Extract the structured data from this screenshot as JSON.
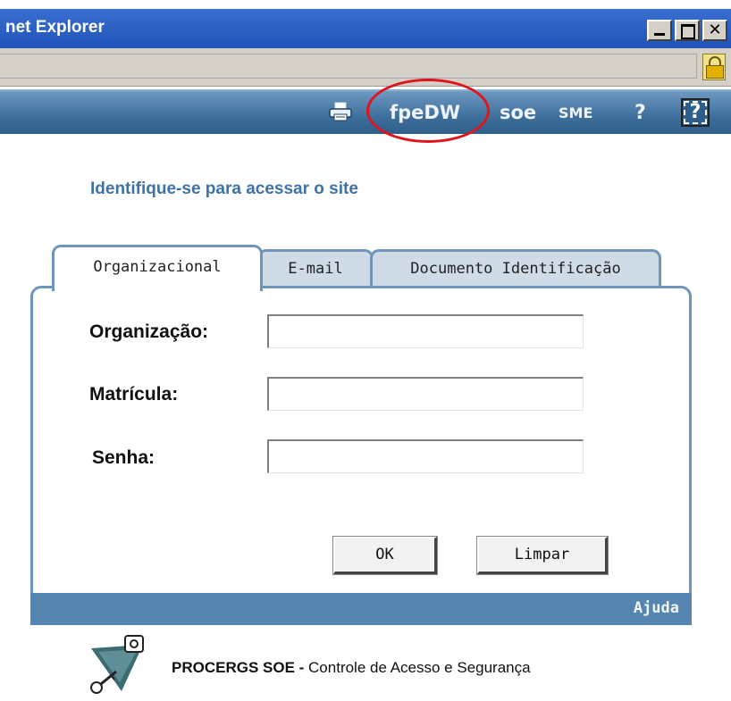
{
  "window": {
    "title": "net Explorer",
    "buttons": {
      "minimize": "minimize",
      "maximize": "maximize",
      "close": "✕"
    }
  },
  "site_header": {
    "links": [
      "fpeDW",
      "soe",
      "SME",
      "?"
    ],
    "icons": [
      "printer-icon",
      "help-box-icon"
    ],
    "annotation": "red circle around fpeDW"
  },
  "page": {
    "heading": "Identifique-se para acessar o site",
    "tabs": [
      {
        "label": "Organizacional",
        "active": true
      },
      {
        "label": "E-mail",
        "active": false
      },
      {
        "label": "Documento Identificação",
        "active": false
      }
    ],
    "form": {
      "fields": [
        {
          "label": "Organização:",
          "value": ""
        },
        {
          "label": "Matrícula:",
          "value": ""
        },
        {
          "label": "Senha:",
          "value": ""
        }
      ],
      "ok_label": "OK",
      "clear_label": "Limpar"
    },
    "footer_help": "Ajuda"
  },
  "brand": {
    "name": "PROCERGS SOE",
    "separator": " - ",
    "description": "Controle de Acesso e Segurança"
  },
  "colors": {
    "title_bar": "#1f53b8",
    "site_bar": "#3e6f9c",
    "heading": "#3f73a8",
    "tab_border": "#6f96b8",
    "annotation": "#e0151b"
  }
}
